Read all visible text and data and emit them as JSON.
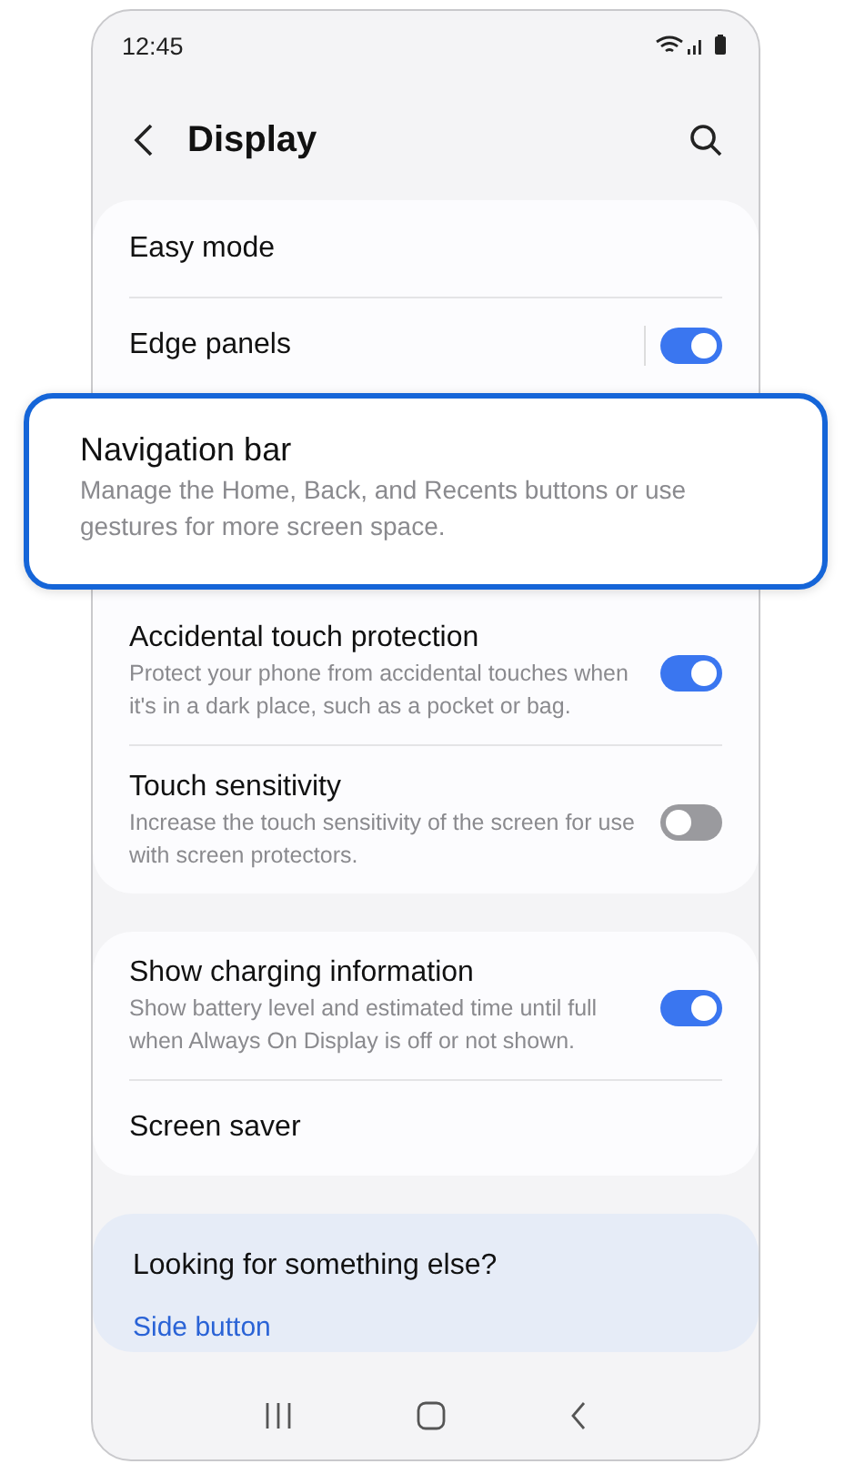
{
  "status_bar": {
    "time": "12:45"
  },
  "header": {
    "title": "Display"
  },
  "groups": [
    {
      "items": [
        {
          "kind": "plain",
          "title": "Easy mode",
          "highlighted": false
        },
        {
          "kind": "switch",
          "title": "Edge panels",
          "on": true,
          "highlighted": false
        },
        {
          "kind": "plain",
          "title": "Navigation bar",
          "summary": "Manage the Home, Back, and Recents buttons or use gestures for more screen space.",
          "highlighted": true
        },
        {
          "kind": "switch",
          "title": "Accidental touch protection",
          "summary": "Protect your phone from accidental touches when it's in a dark place, such as a pocket or bag.",
          "on": true,
          "highlighted": false
        },
        {
          "kind": "switch",
          "title": "Touch sensitivity",
          "summary": "Increase the touch sensitivity of the screen for use with screen protectors.",
          "on": false,
          "highlighted": false
        }
      ]
    },
    {
      "items": [
        {
          "kind": "switch",
          "title": "Show charging information",
          "summary": "Show battery level and estimated time until full when Always On Display is off or not shown.",
          "on": true,
          "highlighted": false
        },
        {
          "kind": "plain",
          "title": "Screen saver",
          "highlighted": false
        }
      ]
    }
  ],
  "suggestions": {
    "title": "Looking for something else?",
    "links": [
      "Side button"
    ]
  }
}
